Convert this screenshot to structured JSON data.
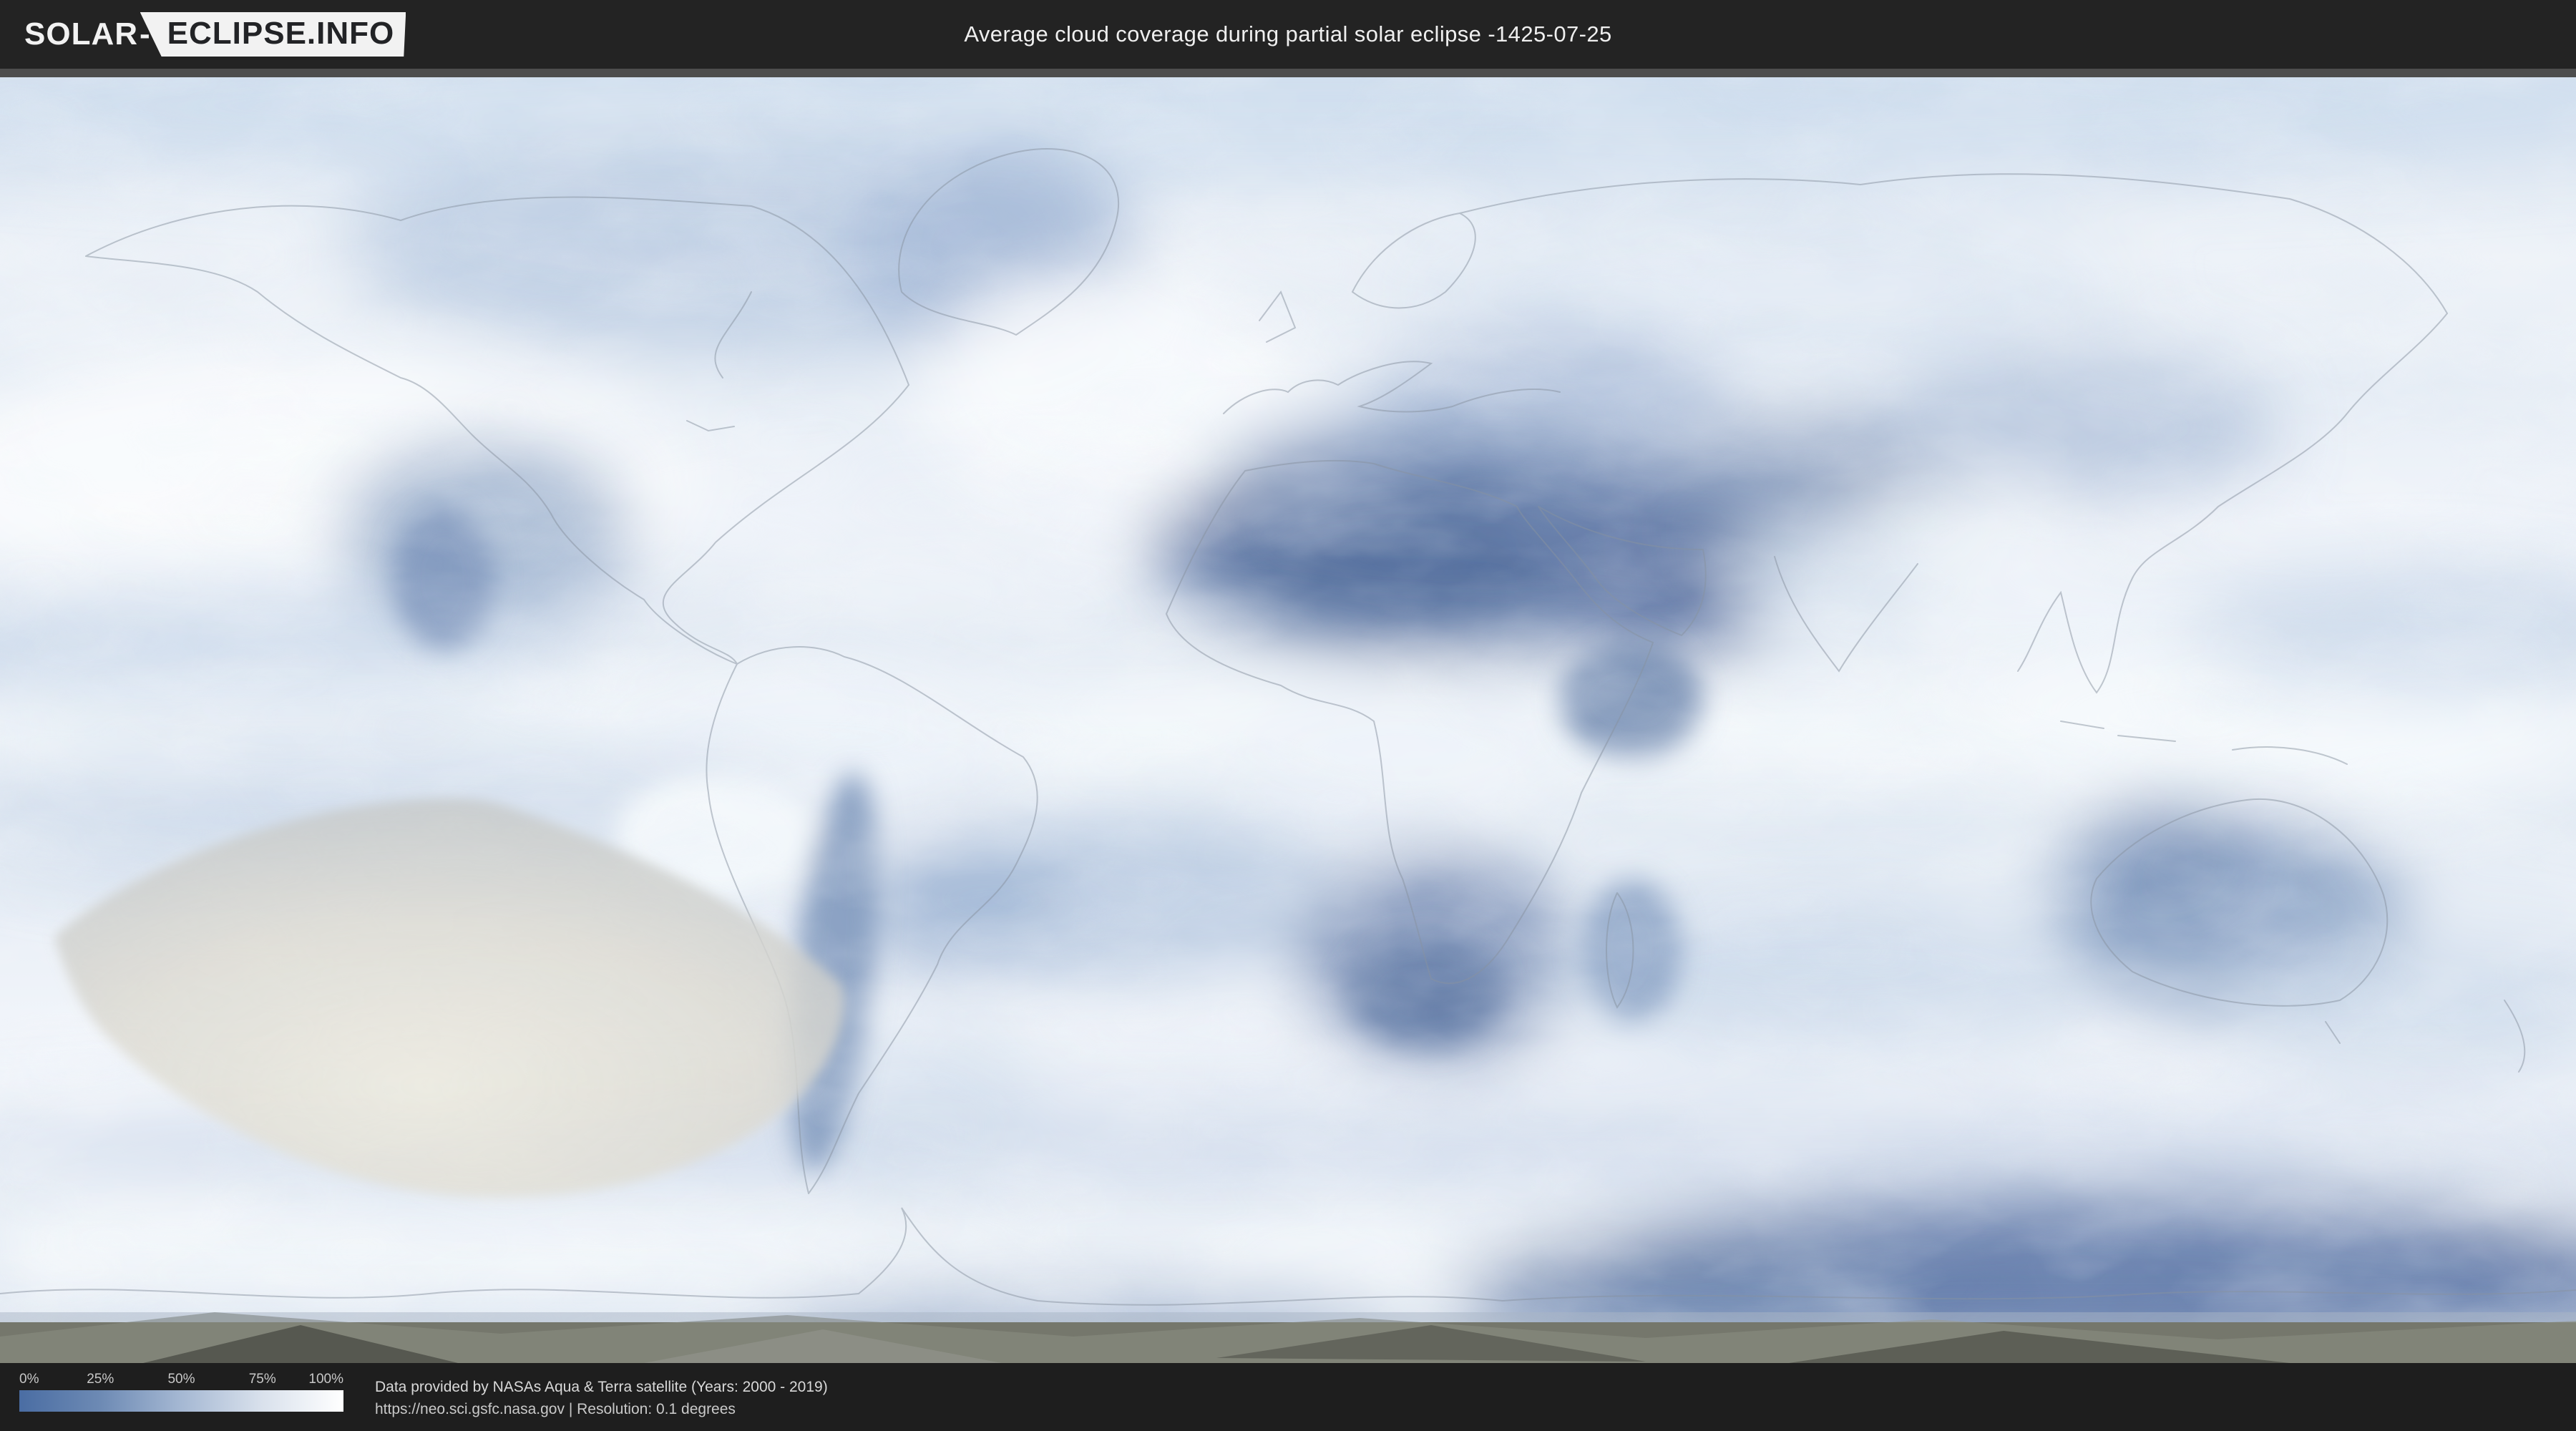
{
  "header": {
    "logo_prefix": "SOLAR",
    "logo_separator": "-",
    "logo_suffix": "ECLIPSE.INFO",
    "title": "Average cloud coverage during partial solar eclipse -1425-07-25"
  },
  "legend": {
    "ticks": [
      "0%",
      "25%",
      "50%",
      "75%",
      "100%"
    ],
    "gradient_start": "#4a6da3",
    "gradient_end": "#ffffff"
  },
  "footer": {
    "attribution_line1": "Data provided by NASAs Aqua & Terra satellite (Years: 2000 - 2019)",
    "attribution_line2": "https://neo.sci.gsfc.nasa.gov | Resolution: 0.1 degrees"
  },
  "colors": {
    "header_background": "#232323",
    "page_background": "#1e1e1e",
    "divider": "#4d4d4d",
    "clear_sky_blue": "#5e77a5",
    "cloudy_white": "#f6f9fc",
    "eclipse_shadow_gray": "#d8d6cf"
  }
}
